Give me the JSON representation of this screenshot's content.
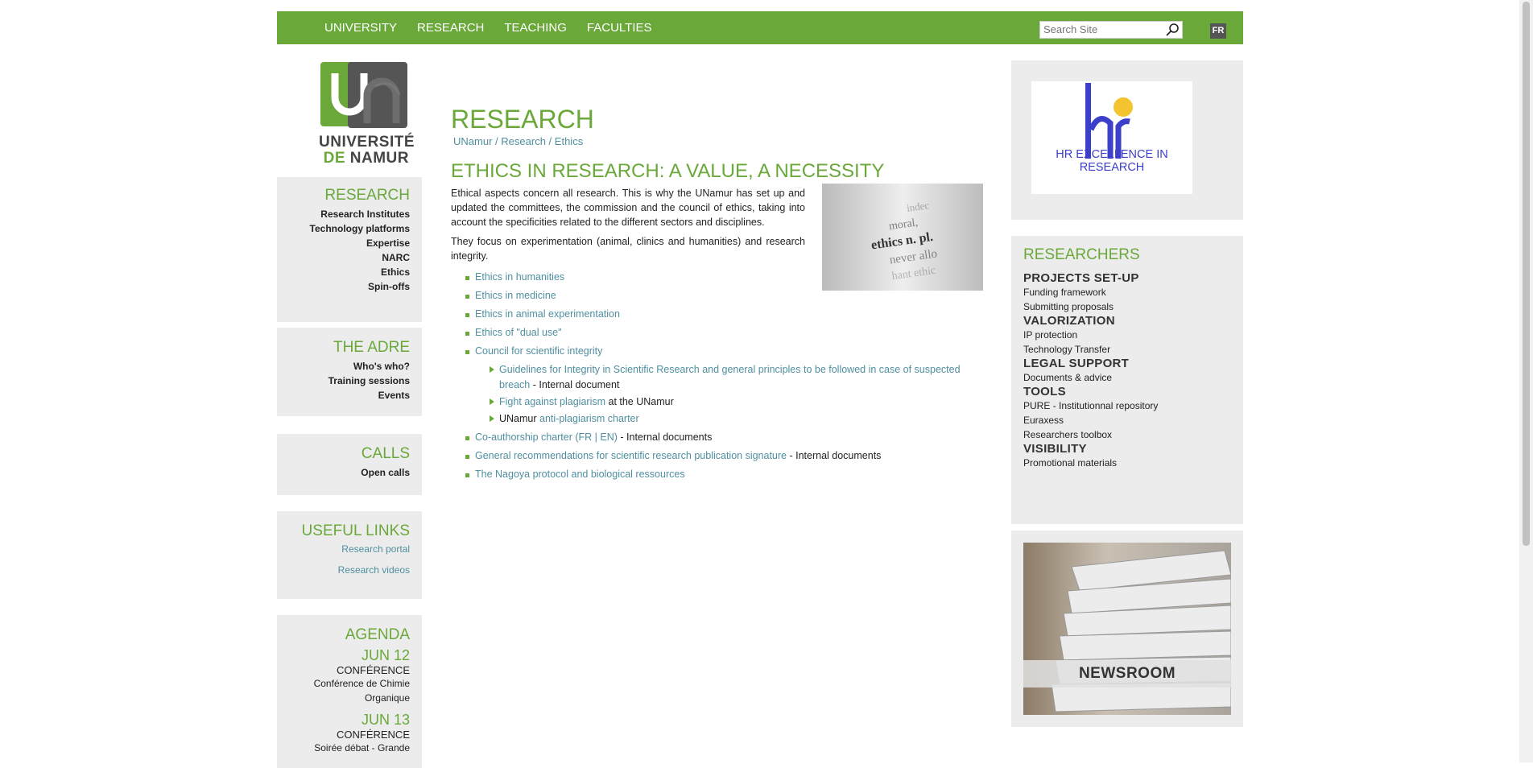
{
  "nav": {
    "items": [
      "UNIVERSITY",
      "RESEARCH",
      "TEACHING",
      "FACULTIES"
    ],
    "search_placeholder": "Search Site",
    "lang": "FR"
  },
  "logo": {
    "line1": "UNIVERSITÉ",
    "line2a": "DE",
    "line2b": "NAMUR"
  },
  "sidebar": {
    "research": {
      "title": "RESEARCH",
      "items": [
        "Research Institutes",
        "Technology platforms",
        "Expertise",
        "NARC",
        "Ethics",
        "Spin-offs"
      ]
    },
    "adre": {
      "title": "THE ADRE",
      "items": [
        "Who's who?",
        "Training sessions",
        "Events"
      ]
    },
    "calls": {
      "title": "CALLS",
      "items": [
        "Open calls"
      ]
    },
    "links": {
      "title": "USEFUL LINKS",
      "items": [
        "Research portal",
        "Research videos"
      ]
    },
    "agenda": {
      "title": "AGENDA",
      "events": [
        {
          "date": "JUN 12",
          "type": "CONFÉRENCE",
          "title1": "Conférence de Chimie",
          "title2": "Organique"
        },
        {
          "date": "JUN 13",
          "type": "CONFÉRENCE",
          "title1": "Soirée débat - Grande",
          "title2": ""
        }
      ]
    }
  },
  "main": {
    "title": "RESEARCH",
    "breadcrumb": [
      "UNamur",
      "/",
      "Research",
      "/",
      "Ethics"
    ],
    "heading": "ETHICS IN RESEARCH: A VALUE, A NECESSITY",
    "para1": "Ethical aspects concern all research. This is why the UNamur has set up and updated the committees, the commission and the council of ethics, taking into account the specificities related to the different sectors and disciplines.",
    "para2": "They focus on experimentation (animal, clinics and humanities) and research integrity.",
    "list": {
      "humanities": "Ethics in humanities",
      "medicine": "Ethics in medicine",
      "animal": "Ethics in animal experimentation",
      "dual": "Ethics of \"dual use\"",
      "council": "Council for scientific integrity",
      "sub1_link": "Guidelines for Integrity in Scientific Research and general principles to be followed in case of suspected breach",
      "sub1_text": " - Internal document",
      "sub2_link": "Fight against plagiarism",
      "sub2_text": " at the UNamur",
      "sub3_pre": "UNamur ",
      "sub3_link": "anti-plagiarism charter",
      "coauth_link": "Co-authorship charter (FR | EN)",
      "coauth_text": " - Internal documents",
      "general_link": "General recommendations for scientific research publication signature",
      "general_text": " - Internal documents",
      "nagoya": "The Nagoya protocol and biological ressources"
    },
    "image_words": [
      "indec",
      "moral,",
      "ethics n. pl.",
      "never allo",
      "hant ethic"
    ]
  },
  "right": {
    "hr_text": "HR EXCELLENCE IN RESEARCH",
    "researchers": {
      "title": "RESEARCHERS",
      "sections": [
        {
          "heading": "PROJECTS SET-UP",
          "items": [
            "Funding framework",
            "Submitting proposals"
          ]
        },
        {
          "heading": "VALORIZATION",
          "items": [
            "IP protection",
            "Technology Transfer"
          ]
        },
        {
          "heading": "LEGAL SUPPORT",
          "items": [
            "Documents & advice"
          ]
        },
        {
          "heading": "TOOLS",
          "items": [
            "PURE - Institutionnal repository",
            "Euraxess",
            "Researchers toolbox"
          ]
        },
        {
          "heading": "VISIBILITY",
          "items": [
            "Promotional materials"
          ]
        }
      ]
    },
    "newsroom": "NEWSROOM"
  },
  "colors": {
    "green": "#6aa83a",
    "link": "#4f8fa0",
    "panel": "#ececec",
    "hr_blue": "#3b3fc9",
    "hr_yellow": "#f4c430"
  }
}
